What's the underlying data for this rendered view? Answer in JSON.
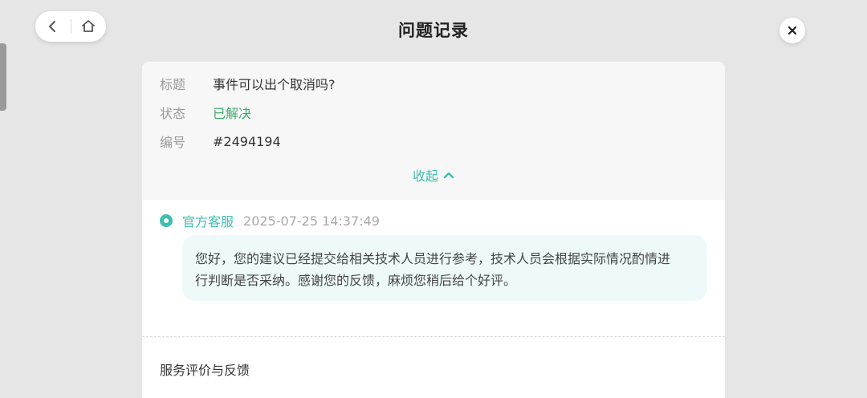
{
  "header": {
    "title": "问题记录",
    "back_icon": "chevron-left-icon",
    "home_icon": "home-icon",
    "close_icon": "close-icon"
  },
  "ticket": {
    "title_label": "标题",
    "title_value": "事件可以出个取消吗?",
    "status_label": "状态",
    "status_value": "已解决",
    "number_label": "编号",
    "number_value": "#2494194",
    "collapse_label": "收起"
  },
  "message": {
    "sender": "官方客服",
    "time": "2025-07-25 14:37:49",
    "line1": "您好，您的建议已经提交给相关技术人员进行参考，技术人员会根据实际情况酌情进",
    "line2": "行判断是否采纳。感谢您的反馈，麻烦您稍后给个好评。"
  },
  "feedback": {
    "title": "服务评价与反馈"
  },
  "colors": {
    "accent": "#3fbfb0",
    "status_green": "#3eab6c",
    "bubble_bg": "#eefafa",
    "page_bg": "#e6e6e6"
  }
}
